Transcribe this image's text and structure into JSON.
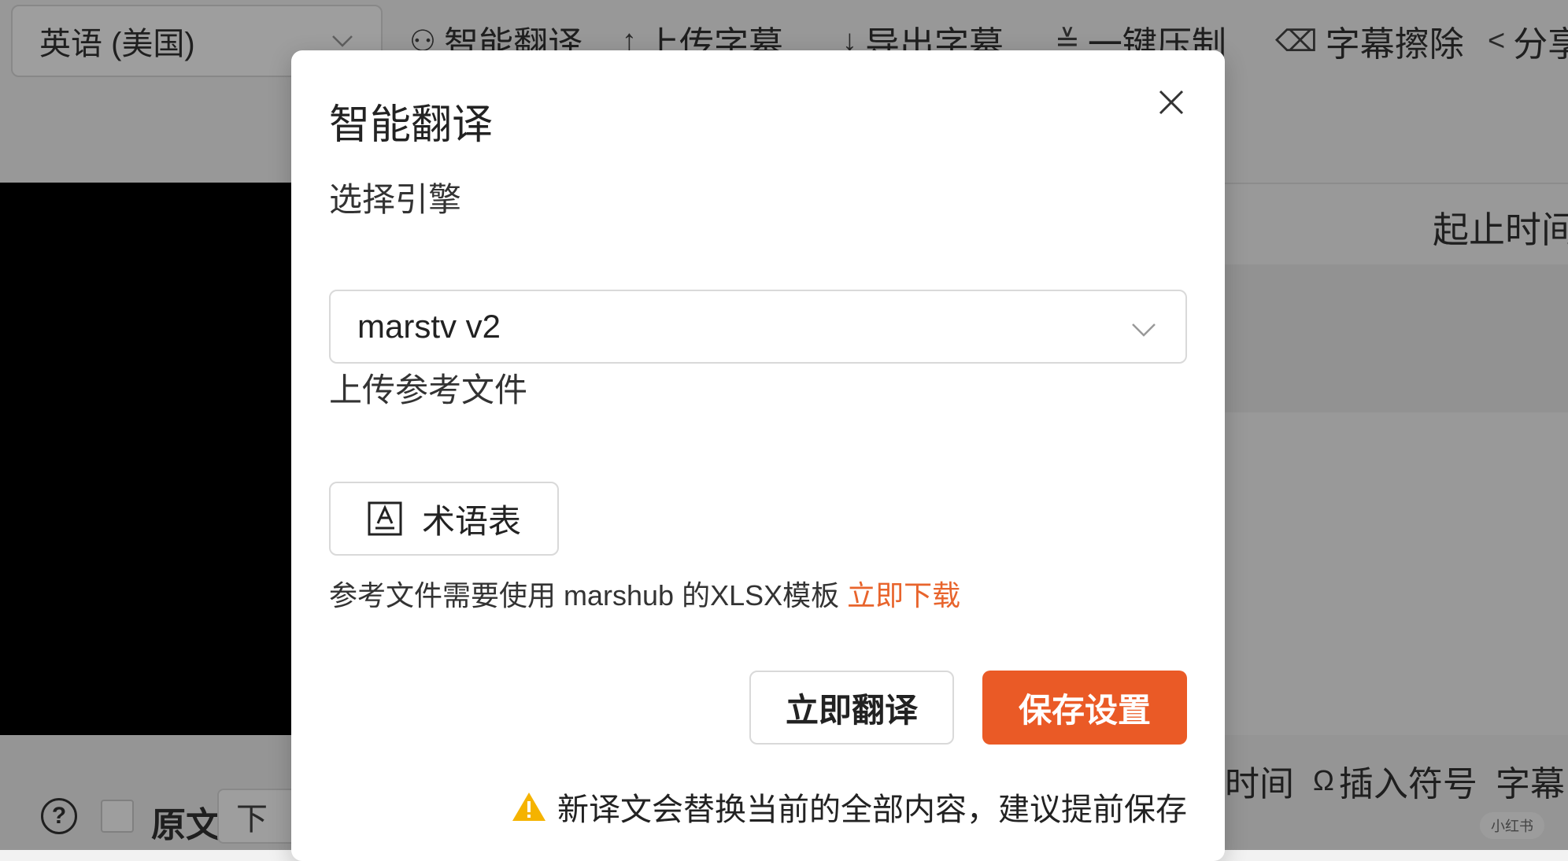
{
  "background": {
    "language_select": "英语 (美国)",
    "toolbar": [
      {
        "icon": "ai-translate-icon",
        "glyph": "⚇",
        "label": "智能翻译"
      },
      {
        "icon": "upload-icon",
        "glyph": "↑",
        "label": "上传字幕"
      },
      {
        "icon": "export-icon",
        "glyph": "↓",
        "label": "导出字幕"
      },
      {
        "icon": "compress-icon",
        "glyph": "≚",
        "label": "一键压制"
      },
      {
        "icon": "eraser-icon",
        "glyph": "⌫",
        "label": "字幕擦除"
      },
      {
        "icon": "share-icon",
        "glyph": "<",
        "label": "分享"
      }
    ],
    "column_header": "起止时间",
    "bottom": {
      "original_label": "原文",
      "position_select": "下",
      "time_label": "时间",
      "insert_symbol": "插入符号",
      "insert_symbol_glyph": "Ω",
      "subtitle_label": "字幕"
    },
    "watermark": "小红书"
  },
  "dialog": {
    "title": "智能翻译",
    "engine_label": "选择引擎",
    "engine_value": "marstv v2",
    "reference_label": "上传参考文件",
    "glossary_button": "术语表",
    "hint_text": "参考文件需要使用 marshub 的XLSX模板 ",
    "hint_link": "立即下载",
    "translate_button": "立即翻译",
    "save_button": "保存设置",
    "warning": "新译文会替换当前的全部内容，建议提前保存"
  },
  "colors": {
    "accent": "#ea5a26",
    "link": "#e8642c",
    "warning": "#f5b300"
  }
}
